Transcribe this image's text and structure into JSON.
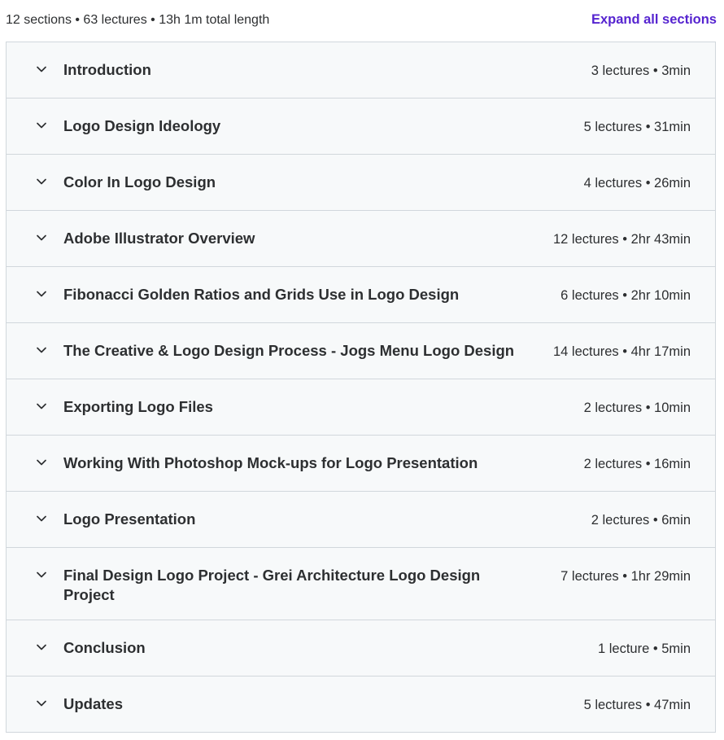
{
  "header": {
    "summary": "12 sections • 63 lectures • 13h 1m total length",
    "expand_label": "Expand all sections"
  },
  "colors": {
    "accent": "#5624d0",
    "section_bg": "#f7f9fa",
    "border": "#d1d7dc",
    "text": "#2d2f31"
  },
  "sections": [
    {
      "title": "Introduction",
      "meta": "3 lectures • 3min",
      "icon": "chevron-down-icon"
    },
    {
      "title": "Logo Design Ideology",
      "meta": "5 lectures • 31min",
      "icon": "chevron-down-icon"
    },
    {
      "title": "Color In Logo Design",
      "meta": "4 lectures • 26min",
      "icon": "chevron-down-icon"
    },
    {
      "title": "Adobe Illustrator Overview",
      "meta": "12 lectures • 2hr 43min",
      "icon": "chevron-down-icon"
    },
    {
      "title": "Fibonacci Golden Ratios and Grids Use in Logo Design",
      "meta": "6 lectures • 2hr 10min",
      "icon": "chevron-down-icon"
    },
    {
      "title": "The Creative & Logo Design Process - Jogs Menu Logo Design",
      "meta": "14 lectures • 4hr 17min",
      "icon": "chevron-down-icon"
    },
    {
      "title": "Exporting Logo Files",
      "meta": "2 lectures • 10min",
      "icon": "chevron-down-icon"
    },
    {
      "title": "Working With Photoshop Mock-ups for Logo Presentation",
      "meta": "2 lectures • 16min",
      "icon": "chevron-down-icon"
    },
    {
      "title": "Logo Presentation",
      "meta": "2 lectures • 6min",
      "icon": "chevron-down-icon"
    },
    {
      "title": "Final Design Logo Project - Grei Architecture Logo Design Project",
      "meta": "7 lectures • 1hr 29min",
      "icon": "chevron-down-icon"
    },
    {
      "title": "Conclusion",
      "meta": "1 lecture • 5min",
      "icon": "chevron-down-icon"
    },
    {
      "title": "Updates",
      "meta": "5 lectures • 47min",
      "icon": "chevron-down-icon"
    }
  ]
}
